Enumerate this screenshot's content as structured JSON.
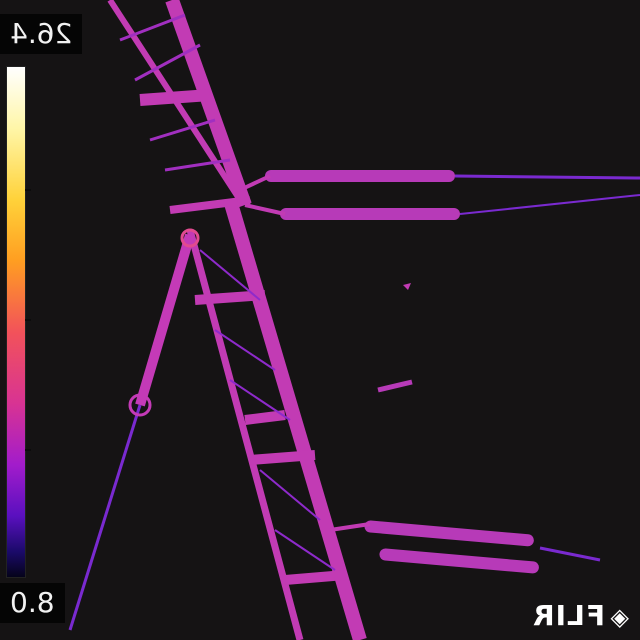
{
  "overlay": {
    "max_temp": "26.4",
    "min_temp": "0.8",
    "brand": "FLIR",
    "brand_icon": "flir-diamond-logo-icon"
  },
  "colors": {
    "background": "#151314",
    "structure_warm": "#c23bb4",
    "structure_cool": "#7a2ad0",
    "hot_spot": "#e24a8f"
  },
  "palette": {
    "name": "iron",
    "stops": [
      "#ffffff",
      "#ffd23a",
      "#ff9e21",
      "#f2525a",
      "#d83393",
      "#a21ccb",
      "#5a10bf",
      "#05031a"
    ]
  }
}
